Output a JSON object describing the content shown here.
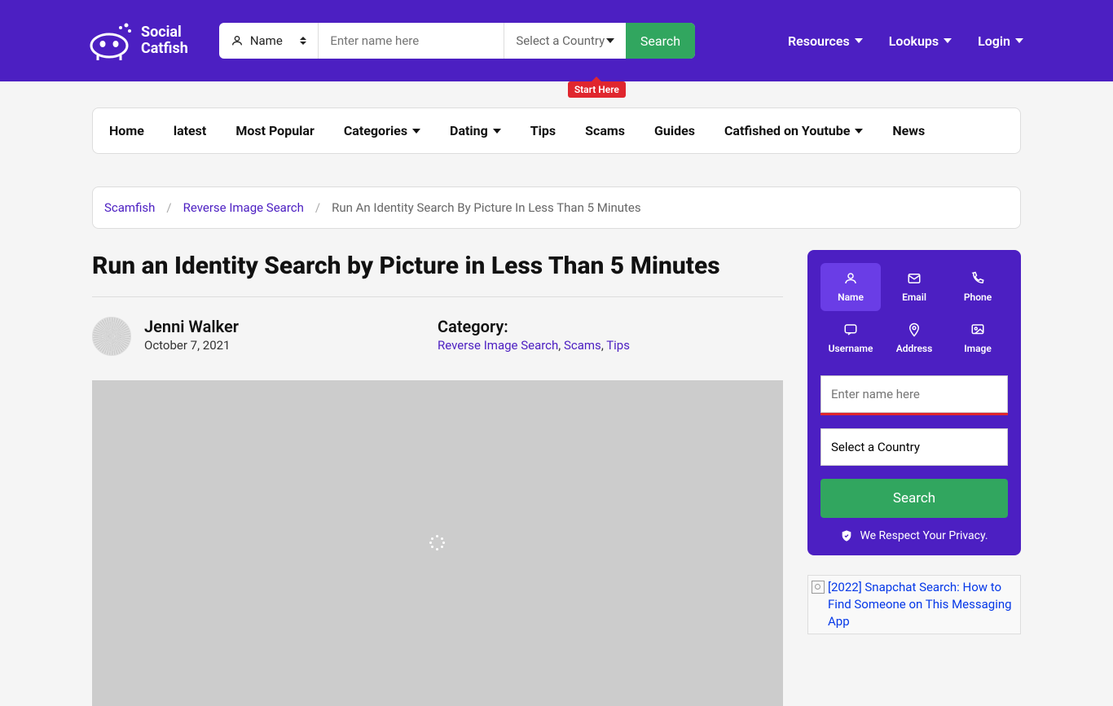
{
  "logo": {
    "line1": "Social",
    "line2": "Catfish"
  },
  "header_search": {
    "type_label": "Name",
    "input_placeholder": "Enter name here",
    "country_label": "Select a Country",
    "button": "Search",
    "start_here": "Start Here"
  },
  "header_nav": {
    "resources": "Resources",
    "lookups": "Lookups",
    "login": "Login"
  },
  "tabs": {
    "home": "Home",
    "latest": "latest",
    "most_popular": "Most Popular",
    "categories": "Categories",
    "dating": "Dating",
    "tips": "Tips",
    "scams": "Scams",
    "guides": "Guides",
    "catfished": "Catfished on Youtube",
    "news": "News"
  },
  "breadcrumb": {
    "item1": "Scamfish",
    "item2": "Reverse Image Search",
    "current": "Run An Identity Search By Picture In Less Than 5 Minutes"
  },
  "article": {
    "title": "Run an Identity Search by Picture in Less Than 5 Minutes",
    "author": "Jenni Walker",
    "date": "October 7, 2021",
    "category_label": "Category:",
    "categories": {
      "c1": "Reverse Image Search",
      "c2": "Scams",
      "c3": "Tips"
    }
  },
  "sidebar_search": {
    "tabs": {
      "name": "Name",
      "email": "Email",
      "phone": "Phone",
      "username": "Username",
      "address": "Address",
      "image": "Image"
    },
    "input_placeholder": "Enter name here",
    "country_label": "Select a Country",
    "button": "Search",
    "privacy": "We Respect Your Privacy."
  },
  "related": {
    "text": "[2022] Snapchat Search: How to Find Someone on This Messaging App"
  }
}
